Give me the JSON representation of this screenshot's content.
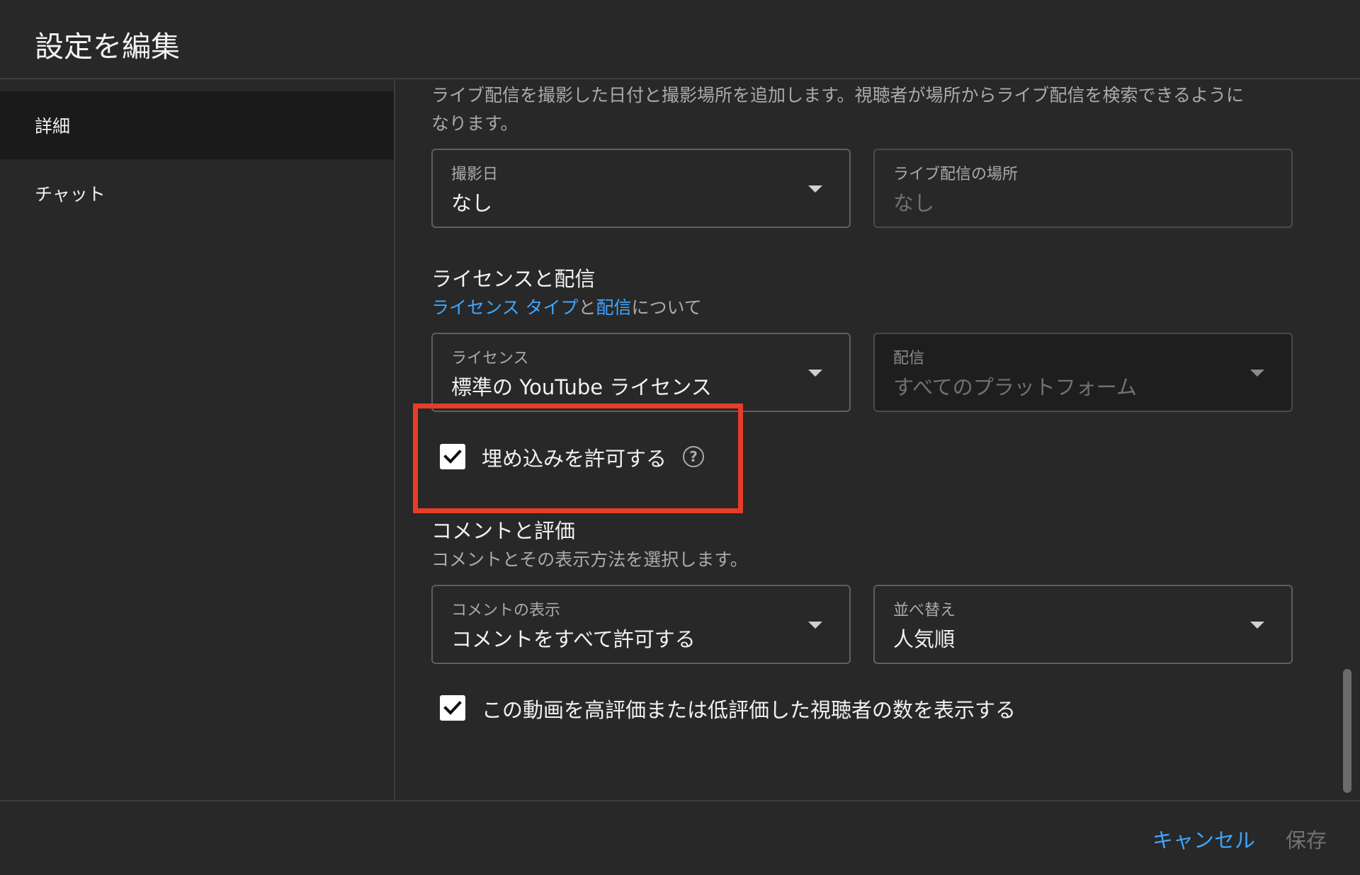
{
  "header": {
    "title": "設定を編集"
  },
  "sidebar": {
    "items": [
      {
        "label": "詳細"
      },
      {
        "label": "チャット"
      }
    ]
  },
  "location_section": {
    "description_line1": "ライブ配信を撮影した日付と撮影場所を追加します。視聴者が場所からライブ配信を検索できるように",
    "description_line2": "なります。",
    "date_field": {
      "label": "撮影日",
      "value": "なし"
    },
    "place_field": {
      "label": "ライブ配信の場所",
      "placeholder": "なし"
    }
  },
  "license_section": {
    "title": "ライセンスと配信",
    "link_license_type": "ライセンス タイプ",
    "text_and": "と",
    "link_distribution": "配信",
    "text_about": "について",
    "license_field": {
      "label": "ライセンス",
      "value": "標準の YouTube ライセンス"
    },
    "distribution_field": {
      "label": "配信",
      "value": "すべてのプラットフォーム"
    },
    "embed_checkbox": {
      "label": "埋め込みを許可する",
      "checked": true,
      "help_glyph": "?"
    }
  },
  "comments_section": {
    "title": "コメントと評価",
    "description": "コメントとその表示方法を選択します。",
    "visibility_field": {
      "label": "コメントの表示",
      "value": "コメントをすべて許可する"
    },
    "sort_field": {
      "label": "並べ替え",
      "value": "人気順"
    },
    "ratings_checkbox": {
      "label": "この動画を高評価または低評価した視聴者の数を表示する",
      "checked": true
    }
  },
  "footer": {
    "cancel_label": "キャンセル",
    "save_label": "保存"
  },
  "colors": {
    "background": "#282828",
    "link": "#3ea6ff",
    "highlight": "#e83c2a",
    "divider": "#3d3d3d"
  }
}
